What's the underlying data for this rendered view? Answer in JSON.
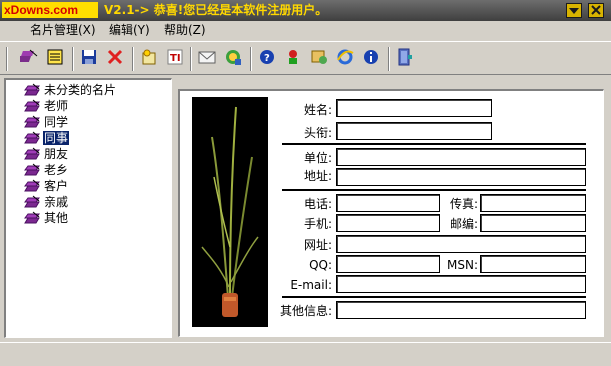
{
  "window": {
    "brand": "xDowns.com",
    "title": "V2.1-> 恭喜!您已经是本软件注册用户。",
    "buttons": [
      "minimize-icon",
      "close-icon"
    ]
  },
  "menu": [
    "名片管理(X)",
    "编辑(Y)",
    "帮助(Z)"
  ],
  "toolbar": {
    "groups": [
      [
        "edit-card-icon",
        "notebook-icon"
      ],
      [
        "save-icon",
        "delete-icon"
      ],
      [
        "new-card-icon",
        "text-icon"
      ],
      [
        "mail-icon",
        "network-icon"
      ],
      [
        "help-icon",
        "money-icon",
        "tools-icon",
        "ie-icon",
        "info-icon"
      ],
      [
        "exit-icon"
      ]
    ]
  },
  "tree": {
    "items": [
      "未分类的名片",
      "老师",
      "同学",
      "同事",
      "朋友",
      "老乡",
      "客户",
      "亲戚",
      "其他"
    ],
    "selected_index": 3
  },
  "form": {
    "name_label": "姓名:",
    "title_label": "头衔:",
    "company_label": "单位:",
    "address_label": "地址:",
    "phone_label": "电话:",
    "fax_label": "传真:",
    "mobile_label": "手机:",
    "zip_label": "邮编:",
    "web_label": "网址:",
    "qq_label": "QQ:",
    "msn_label": "MSN:",
    "email_label": "E-mail:",
    "other_label": "其他信息:",
    "values": {
      "name": "",
      "title": "",
      "company": "",
      "address": "",
      "phone": "",
      "fax": "",
      "mobile": "",
      "zip": "",
      "web": "",
      "qq": "",
      "msn": "",
      "email": "",
      "other": ""
    }
  },
  "colors": {
    "titlebar": "#4a4a4a",
    "title_text": "#ffd800",
    "brand_bg": "#ffde00",
    "brand_text": "#d40000",
    "selection": "#0a246a",
    "face": "#d4d0c8"
  }
}
